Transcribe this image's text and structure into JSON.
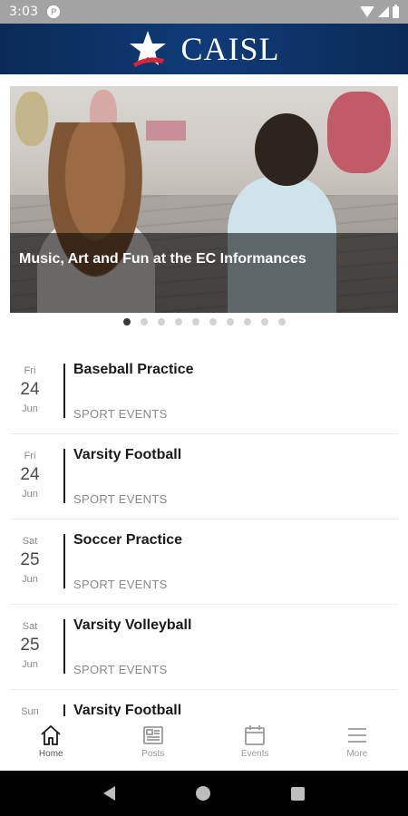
{
  "status_bar": {
    "time": "3:03",
    "notification_icon": "app-notification-icon",
    "icons": [
      "wifi-icon",
      "signal-icon",
      "battery-icon"
    ]
  },
  "header": {
    "logo_text": "CAISL",
    "logo_icon": "star-swoosh-logo",
    "brand_color": "#0f3b78"
  },
  "hero": {
    "caption": "Music, Art and Fun at the EC Informances",
    "slide_count": 10,
    "active_slide": 1
  },
  "events": [
    {
      "dow": "Fri",
      "day": "24",
      "month": "Jun",
      "title": "Baseball Practice",
      "category": "SPORT EVENTS"
    },
    {
      "dow": "Fri",
      "day": "24",
      "month": "Jun",
      "title": "Varsity Football",
      "category": "SPORT EVENTS"
    },
    {
      "dow": "Sat",
      "day": "25",
      "month": "Jun",
      "title": "Soccer Practice",
      "category": "SPORT EVENTS"
    },
    {
      "dow": "Sat",
      "day": "25",
      "month": "Jun",
      "title": "Varsity Volleyball",
      "category": "SPORT EVENTS"
    },
    {
      "dow": "Sun",
      "day": "",
      "month": "",
      "title": "Varsity Football",
      "category": ""
    }
  ],
  "bottom_nav": {
    "items": [
      {
        "label": "Home",
        "icon": "home-icon",
        "active": true
      },
      {
        "label": "Posts",
        "icon": "newspaper-icon",
        "active": false
      },
      {
        "label": "Events",
        "icon": "calendar-icon",
        "active": false
      },
      {
        "label": "More",
        "icon": "menu-icon",
        "active": false
      }
    ]
  },
  "system_nav": {
    "icons": [
      "back-icon",
      "home-circle-icon",
      "recents-icon"
    ]
  }
}
